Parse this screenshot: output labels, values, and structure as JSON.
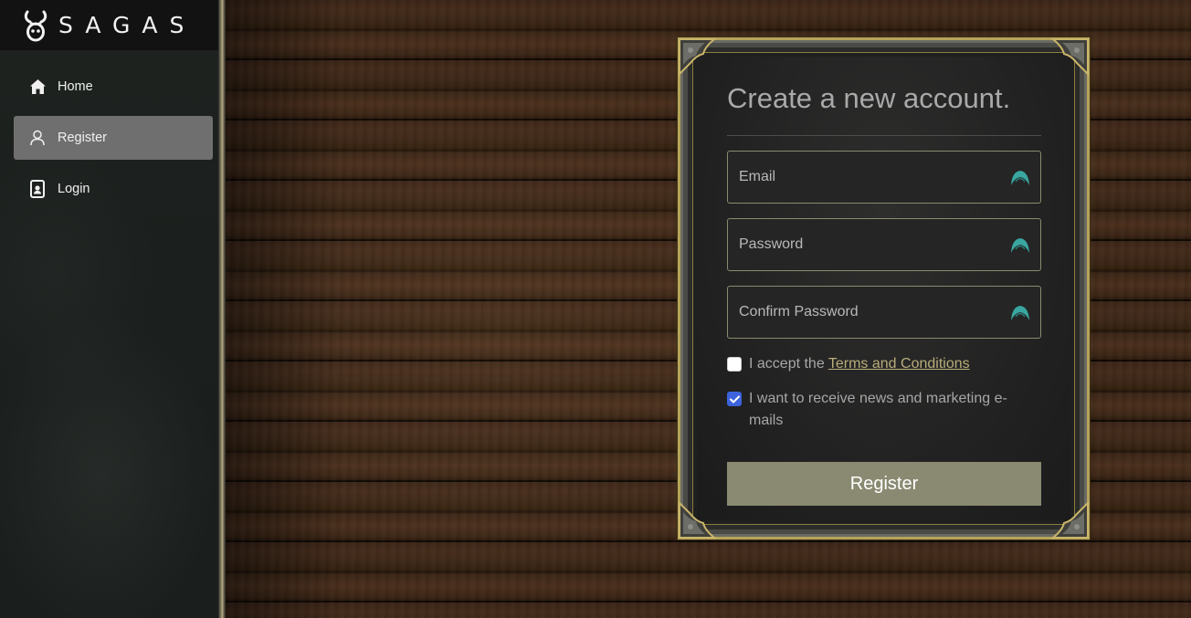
{
  "brand": {
    "name": "SAGAS",
    "logo_icon": "horned-skull-icon"
  },
  "sidebar": {
    "items": [
      {
        "label": "Home",
        "icon": "home-icon",
        "active": false
      },
      {
        "label": "Register",
        "icon": "user-icon",
        "active": true
      },
      {
        "label": "Login",
        "icon": "id-badge-icon",
        "active": false
      }
    ]
  },
  "form": {
    "title": "Create a new account.",
    "fields": {
      "email": {
        "placeholder": "Email",
        "value": ""
      },
      "password": {
        "placeholder": "Password",
        "value": ""
      },
      "confirm_password": {
        "placeholder": "Confirm Password",
        "value": ""
      }
    },
    "field_icon": "password-manager-icon",
    "terms": {
      "prefix": "I accept the ",
      "link": "Terms and Conditions",
      "checked": false
    },
    "marketing": {
      "label": "I want to receive news and marketing e-mails",
      "checked": true
    },
    "submit_label": "Register"
  },
  "colors": {
    "accent_gold": "#b7a45a",
    "button": "#8a8a72",
    "nav_active": "#6f6f6f",
    "checkbox_checked": "#3d63dd",
    "field_icon": "#3aa6a0"
  }
}
